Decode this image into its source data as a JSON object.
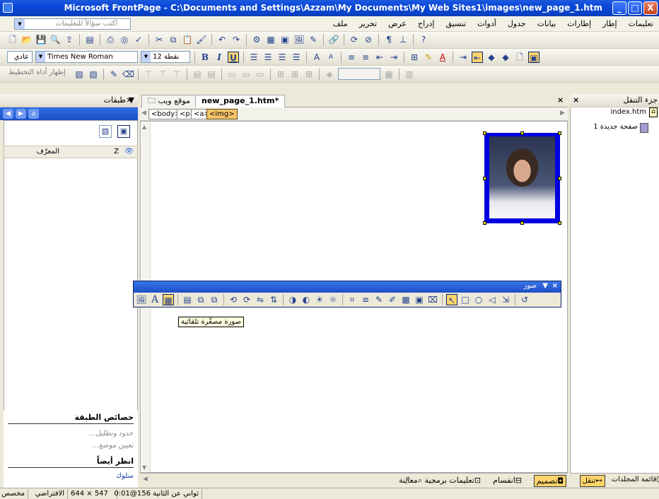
{
  "window": {
    "title": "Microsoft FrontPage - C:\\Documents and Settings\\Azzam\\My Documents\\My Web Sites1\\images\\new_page_1.htm",
    "minimize": "_",
    "maximize": "□",
    "close": "X"
  },
  "menubar": {
    "ask_placeholder": "اكتب سؤالاً للتعليمات",
    "items": [
      "ملف",
      "تحرير",
      "عرض",
      "إدراج",
      "تنسيق",
      "أدوات",
      "جدول",
      "بيانات",
      "إطارات",
      "إطار",
      "تعليمات"
    ]
  },
  "format_toolbar": {
    "style": "عادي",
    "font": "Times New Roman",
    "size": "12 نقطة",
    "bold": "B",
    "italic": "I",
    "underline": "U"
  },
  "drawing_toolbar": {
    "show_drawing_grid": "إظهار أداة التخطيط"
  },
  "layers_panel": {
    "title": "طبقات",
    "col_z": "Z",
    "col_id": "المعرّف",
    "properties_heading": "خصائص الطبقة",
    "borders_link": "حدود وتظليل...",
    "position_link": "تعيين موضع...",
    "see_also_heading": "انظر أيضاً",
    "behaviors_link": "سلوك"
  },
  "document_tabs": {
    "website_tab": "موقع ويب",
    "page_tab": "new_page_1.htm*",
    "close": "×"
  },
  "tag_selector": [
    "<body>",
    "<p>",
    "<a>",
    "<img>"
  ],
  "pictures_toolbar": {
    "title": "صور",
    "tooltip": "صورة مصغّرة تلقائية"
  },
  "view_tabs": {
    "design": "تصميم",
    "split": "انقسام",
    "code": "تعليمات برمجية",
    "preview": "معاينة"
  },
  "nav_pane": {
    "title": "جزء التنقل",
    "root": "index.htm",
    "child": "صفحة جديدة 1",
    "folder_list_tab": "قائمة المجلدات",
    "navigation_tab": "تنقل"
  },
  "statusbar": {
    "mode": "مخصص",
    "default": "الافتراضي",
    "dimensions": "644 × 547",
    "download": "ثواني عن الثانية 156@0:01"
  }
}
